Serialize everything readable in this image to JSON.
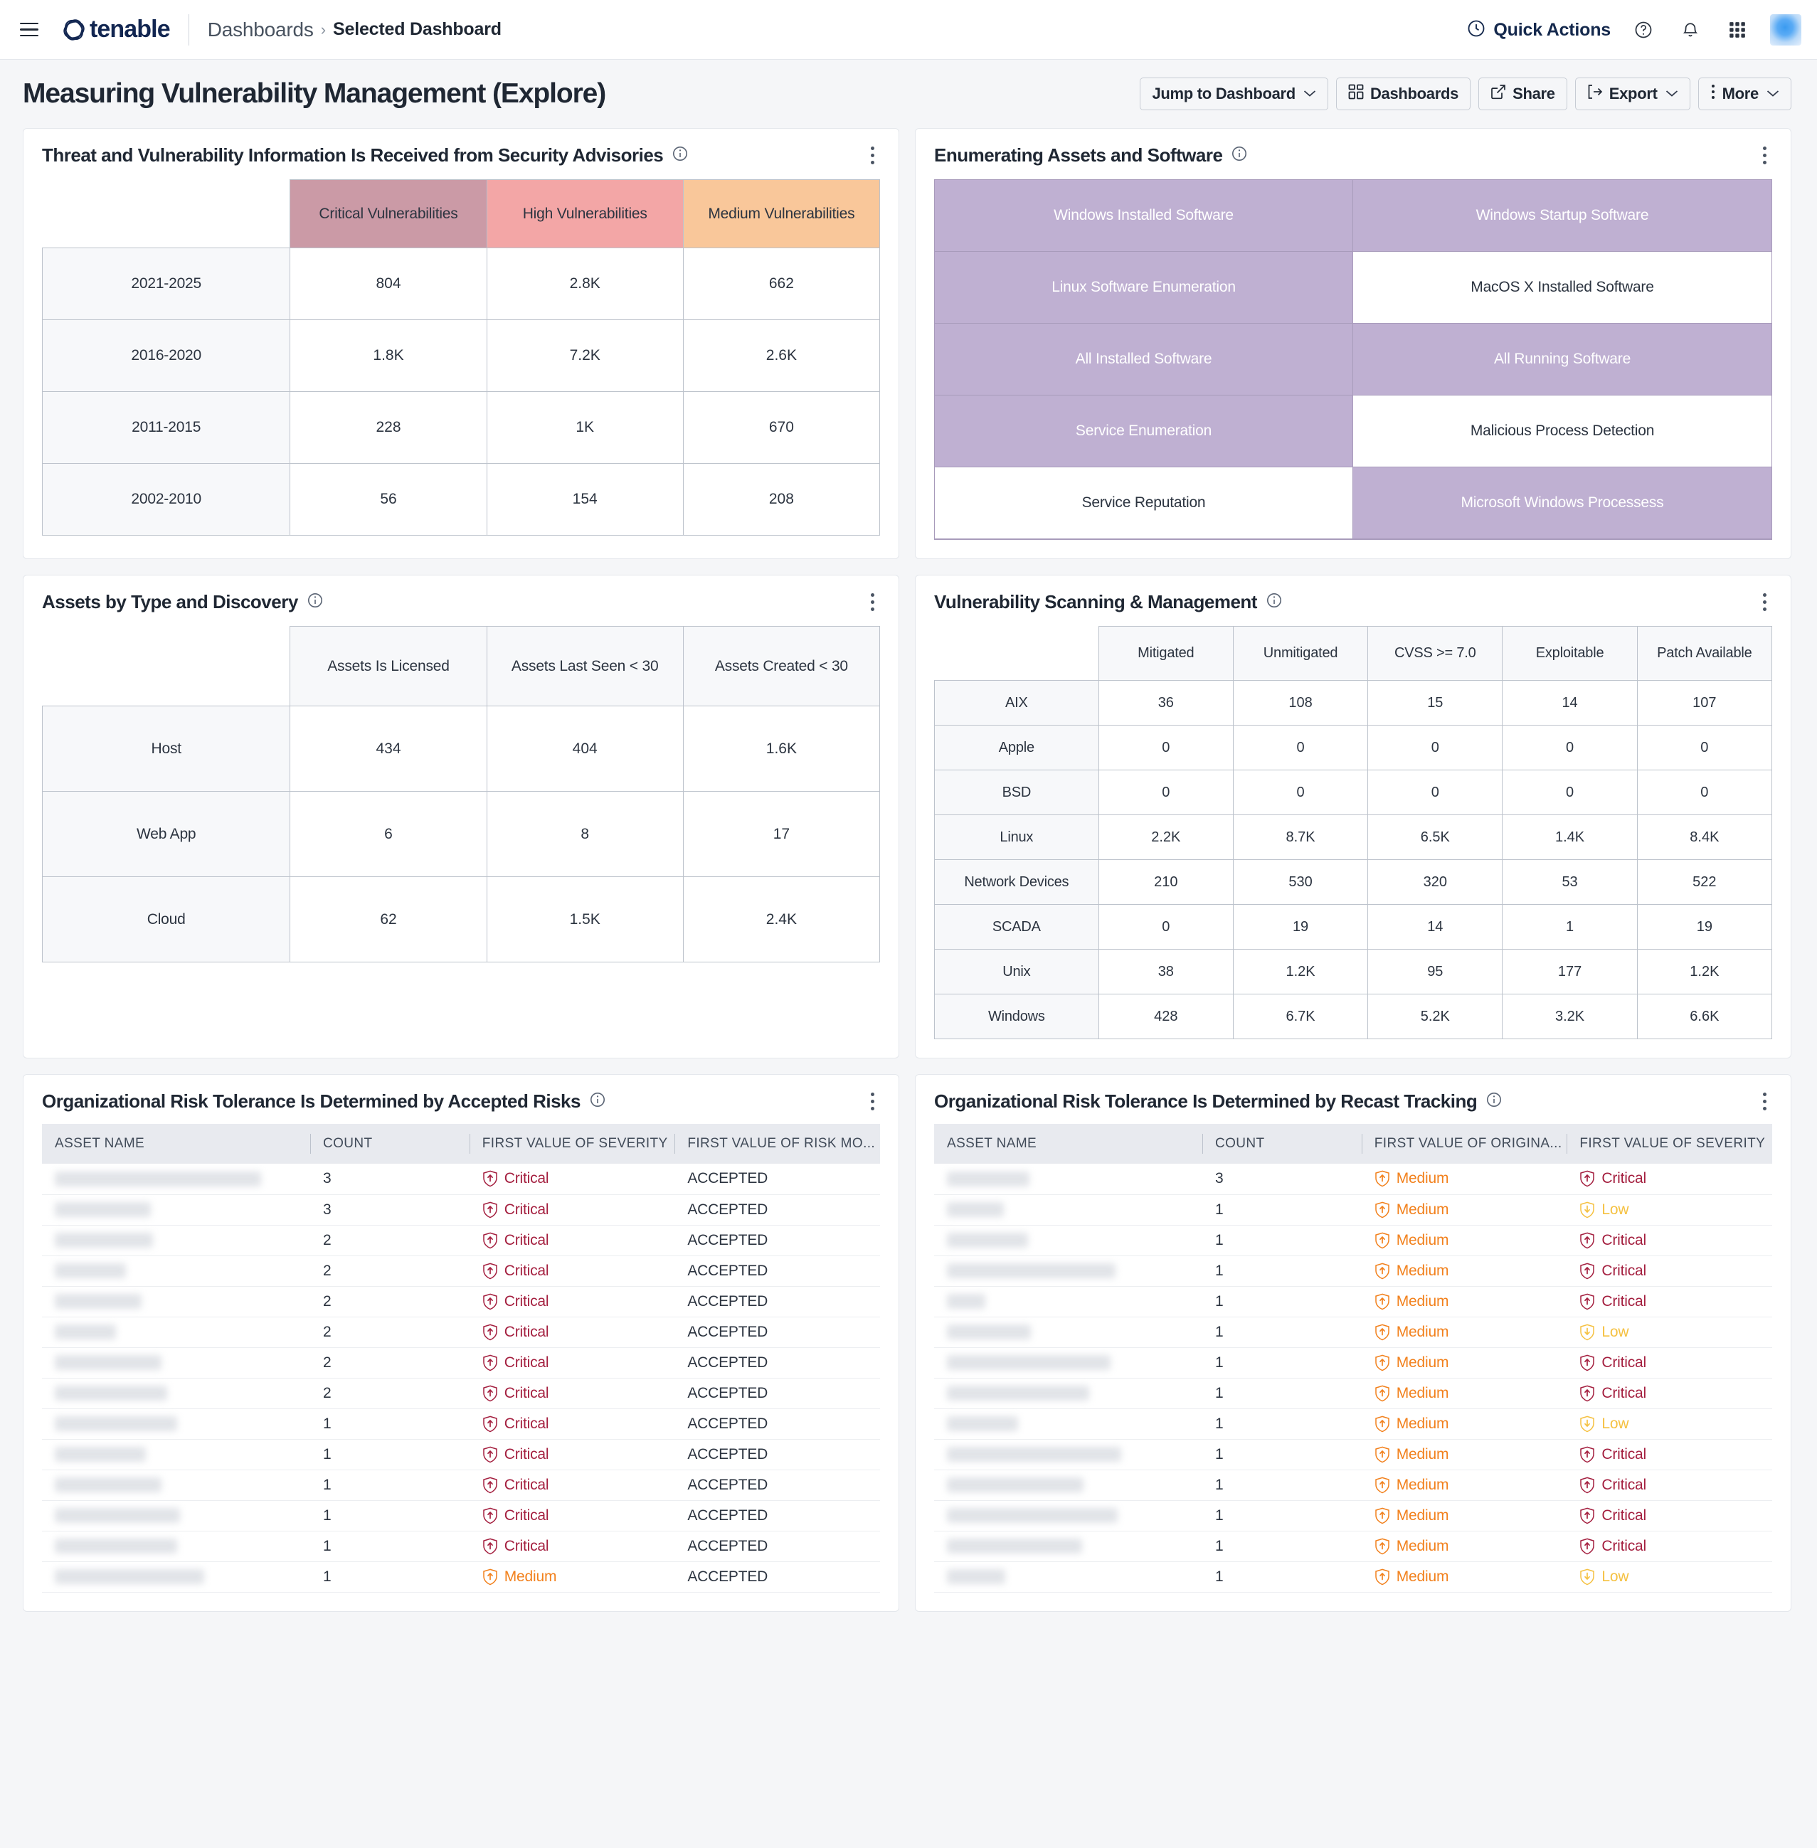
{
  "nav": {
    "menu_icon": "hamburger-icon",
    "brand": "tenable",
    "breadcrumb_root": "Dashboards",
    "breadcrumb_sep": "›",
    "breadcrumb_current": "Selected Dashboard",
    "quick_actions": "Quick Actions",
    "help_icon": "help-circle-icon",
    "bell_icon": "notification-bell-icon",
    "apps_icon": "app-grid-icon",
    "avatar": "user-avatar"
  },
  "page": {
    "title": "Measuring Vulnerability Management (Explore)",
    "toolbar": {
      "jump_to_dashboard": "Jump to Dashboard",
      "dashboards": "Dashboards",
      "share": "Share",
      "export": "Export",
      "more": "More"
    }
  },
  "widgets": {
    "threat_advisories": {
      "title": "Threat and Vulnerability Information Is Received from Security Advisories",
      "columns": [
        "Critical Vulnerabilities",
        "High Vulnerabilities",
        "Medium Vulnerabilities"
      ],
      "column_colors": [
        "#cb9aa6",
        "#f3a6a6",
        "#f9c79a"
      ],
      "rows": [
        {
          "label": "2021-2025",
          "values": [
            "804",
            "2.8K",
            "662"
          ]
        },
        {
          "label": "2016-2020",
          "values": [
            "1.8K",
            "7.2K",
            "2.6K"
          ]
        },
        {
          "label": "2011-2015",
          "values": [
            "228",
            "1K",
            "670"
          ]
        },
        {
          "label": "2002-2010",
          "values": [
            "56",
            "154",
            "208"
          ]
        }
      ]
    },
    "enumerating": {
      "title": "Enumerating Assets and Software",
      "tiles": [
        {
          "label": "Windows Installed Software",
          "filled": true
        },
        {
          "label": "Windows Startup Software",
          "filled": true
        },
        {
          "label": "Linux Software Enumeration",
          "filled": true
        },
        {
          "label": "MacOS X Installed Software",
          "filled": false
        },
        {
          "label": "All Installed Software",
          "filled": true
        },
        {
          "label": "All Running Software",
          "filled": true
        },
        {
          "label": "Service Enumeration",
          "filled": true
        },
        {
          "label": "Malicious Process Detection",
          "filled": false
        },
        {
          "label": "Service Reputation",
          "filled": false
        },
        {
          "label": "Microsoft Windows Processess",
          "filled": true
        }
      ],
      "fill_color": "#bfb0d2"
    },
    "assets_by_type": {
      "title": "Assets by Type and Discovery",
      "columns": [
        "Assets Is Licensed",
        "Assets Last Seen < 30",
        "Assets Created < 30"
      ],
      "rows": [
        {
          "label": "Host",
          "values": [
            "434",
            "404",
            "1.6K"
          ]
        },
        {
          "label": "Web App",
          "values": [
            "6",
            "8",
            "17"
          ]
        },
        {
          "label": "Cloud",
          "values": [
            "62",
            "1.5K",
            "2.4K"
          ]
        }
      ]
    },
    "vuln_scanning": {
      "title": "Vulnerability Scanning & Management",
      "columns": [
        "Mitigated",
        "Unmitigated",
        "CVSS >= 7.0",
        "Exploitable",
        "Patch Available"
      ],
      "rows": [
        {
          "label": "AIX",
          "values": [
            "36",
            "108",
            "15",
            "14",
            "107"
          ]
        },
        {
          "label": "Apple",
          "values": [
            "0",
            "0",
            "0",
            "0",
            "0"
          ]
        },
        {
          "label": "BSD",
          "values": [
            "0",
            "0",
            "0",
            "0",
            "0"
          ]
        },
        {
          "label": "Linux",
          "values": [
            "2.2K",
            "8.7K",
            "6.5K",
            "1.4K",
            "8.4K"
          ]
        },
        {
          "label": "Network Devices",
          "values": [
            "210",
            "530",
            "320",
            "53",
            "522"
          ]
        },
        {
          "label": "SCADA",
          "values": [
            "0",
            "19",
            "14",
            "1",
            "19"
          ]
        },
        {
          "label": "Unix",
          "values": [
            "38",
            "1.2K",
            "95",
            "177",
            "1.2K"
          ]
        },
        {
          "label": "Windows",
          "values": [
            "428",
            "6.7K",
            "5.2K",
            "3.2K",
            "6.6K"
          ]
        }
      ]
    },
    "accepted_risks": {
      "title": "Organizational Risk Tolerance Is Determined by Accepted Risks",
      "columns": [
        "ASSET NAME",
        "COUNT",
        "FIRST VALUE OF SEVERITY",
        "FIRST VALUE OF RISK MO..."
      ],
      "rows": [
        {
          "asset_redacted_width": 290,
          "count": "3",
          "severity": "Critical",
          "risk": "ACCEPTED"
        },
        {
          "asset_redacted_width": 135,
          "count": "3",
          "severity": "Critical",
          "risk": "ACCEPTED"
        },
        {
          "asset_redacted_width": 138,
          "count": "2",
          "severity": "Critical",
          "risk": "ACCEPTED"
        },
        {
          "asset_redacted_width": 100,
          "count": "2",
          "severity": "Critical",
          "risk": "ACCEPTED"
        },
        {
          "asset_redacted_width": 122,
          "count": "2",
          "severity": "Critical",
          "risk": "ACCEPTED"
        },
        {
          "asset_redacted_width": 86,
          "count": "2",
          "severity": "Critical",
          "risk": "ACCEPTED"
        },
        {
          "asset_redacted_width": 150,
          "count": "2",
          "severity": "Critical",
          "risk": "ACCEPTED"
        },
        {
          "asset_redacted_width": 158,
          "count": "2",
          "severity": "Critical",
          "risk": "ACCEPTED"
        },
        {
          "asset_redacted_width": 172,
          "count": "1",
          "severity": "Critical",
          "risk": "ACCEPTED"
        },
        {
          "asset_redacted_width": 128,
          "count": "1",
          "severity": "Critical",
          "risk": "ACCEPTED"
        },
        {
          "asset_redacted_width": 150,
          "count": "1",
          "severity": "Critical",
          "risk": "ACCEPTED"
        },
        {
          "asset_redacted_width": 176,
          "count": "1",
          "severity": "Critical",
          "risk": "ACCEPTED"
        },
        {
          "asset_redacted_width": 172,
          "count": "1",
          "severity": "Critical",
          "risk": "ACCEPTED"
        },
        {
          "asset_redacted_width": 210,
          "count": "1",
          "severity": "Medium",
          "risk": "ACCEPTED"
        }
      ]
    },
    "recast_tracking": {
      "title": "Organizational Risk Tolerance Is Determined by Recast Tracking",
      "columns": [
        "ASSET NAME",
        "COUNT",
        "FIRST VALUE OF ORIGINA...",
        "FIRST VALUE OF SEVERITY"
      ],
      "rows": [
        {
          "asset_redacted_width": 116,
          "count": "3",
          "original": "Medium",
          "severity": "Critical"
        },
        {
          "asset_redacted_width": 80,
          "count": "1",
          "original": "Medium",
          "severity": "Low"
        },
        {
          "asset_redacted_width": 114,
          "count": "1",
          "original": "Medium",
          "severity": "Critical"
        },
        {
          "asset_redacted_width": 237,
          "count": "1",
          "original": "Medium",
          "severity": "Critical"
        },
        {
          "asset_redacted_width": 54,
          "count": "1",
          "original": "Medium",
          "severity": "Critical"
        },
        {
          "asset_redacted_width": 118,
          "count": "1",
          "original": "Medium",
          "severity": "Low"
        },
        {
          "asset_redacted_width": 230,
          "count": "1",
          "original": "Medium",
          "severity": "Critical"
        },
        {
          "asset_redacted_width": 200,
          "count": "1",
          "original": "Medium",
          "severity": "Critical"
        },
        {
          "asset_redacted_width": 100,
          "count": "1",
          "original": "Medium",
          "severity": "Low"
        },
        {
          "asset_redacted_width": 245,
          "count": "1",
          "original": "Medium",
          "severity": "Critical"
        },
        {
          "asset_redacted_width": 192,
          "count": "1",
          "original": "Medium",
          "severity": "Critical"
        },
        {
          "asset_redacted_width": 240,
          "count": "1",
          "original": "Medium",
          "severity": "Critical"
        },
        {
          "asset_redacted_width": 190,
          "count": "1",
          "original": "Medium",
          "severity": "Critical"
        },
        {
          "asset_redacted_width": 82,
          "count": "1",
          "original": "Medium",
          "severity": "Low"
        }
      ]
    }
  },
  "colors": {
    "critical": "#a41f3f",
    "medium": "#f2811d",
    "low": "#f5c141",
    "brand_navy": "#122651",
    "tile_purple": "#bfb0d2"
  }
}
